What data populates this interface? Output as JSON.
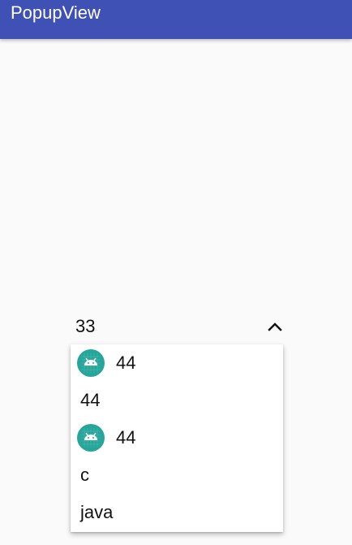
{
  "app": {
    "title": "PopupView"
  },
  "spinner": {
    "selected": "33",
    "arrow_icon": "chevron-up-icon"
  },
  "popup": {
    "items": [
      {
        "label": "44",
        "icon": "android-icon"
      },
      {
        "label": "44",
        "icon": null
      },
      {
        "label": "44",
        "icon": "android-icon"
      },
      {
        "label": "c",
        "icon": null
      },
      {
        "label": "java",
        "icon": null
      }
    ]
  },
  "colors": {
    "appbar": "#3f51b5",
    "icon_bg": "#26a69a",
    "background": "#fafafa"
  }
}
